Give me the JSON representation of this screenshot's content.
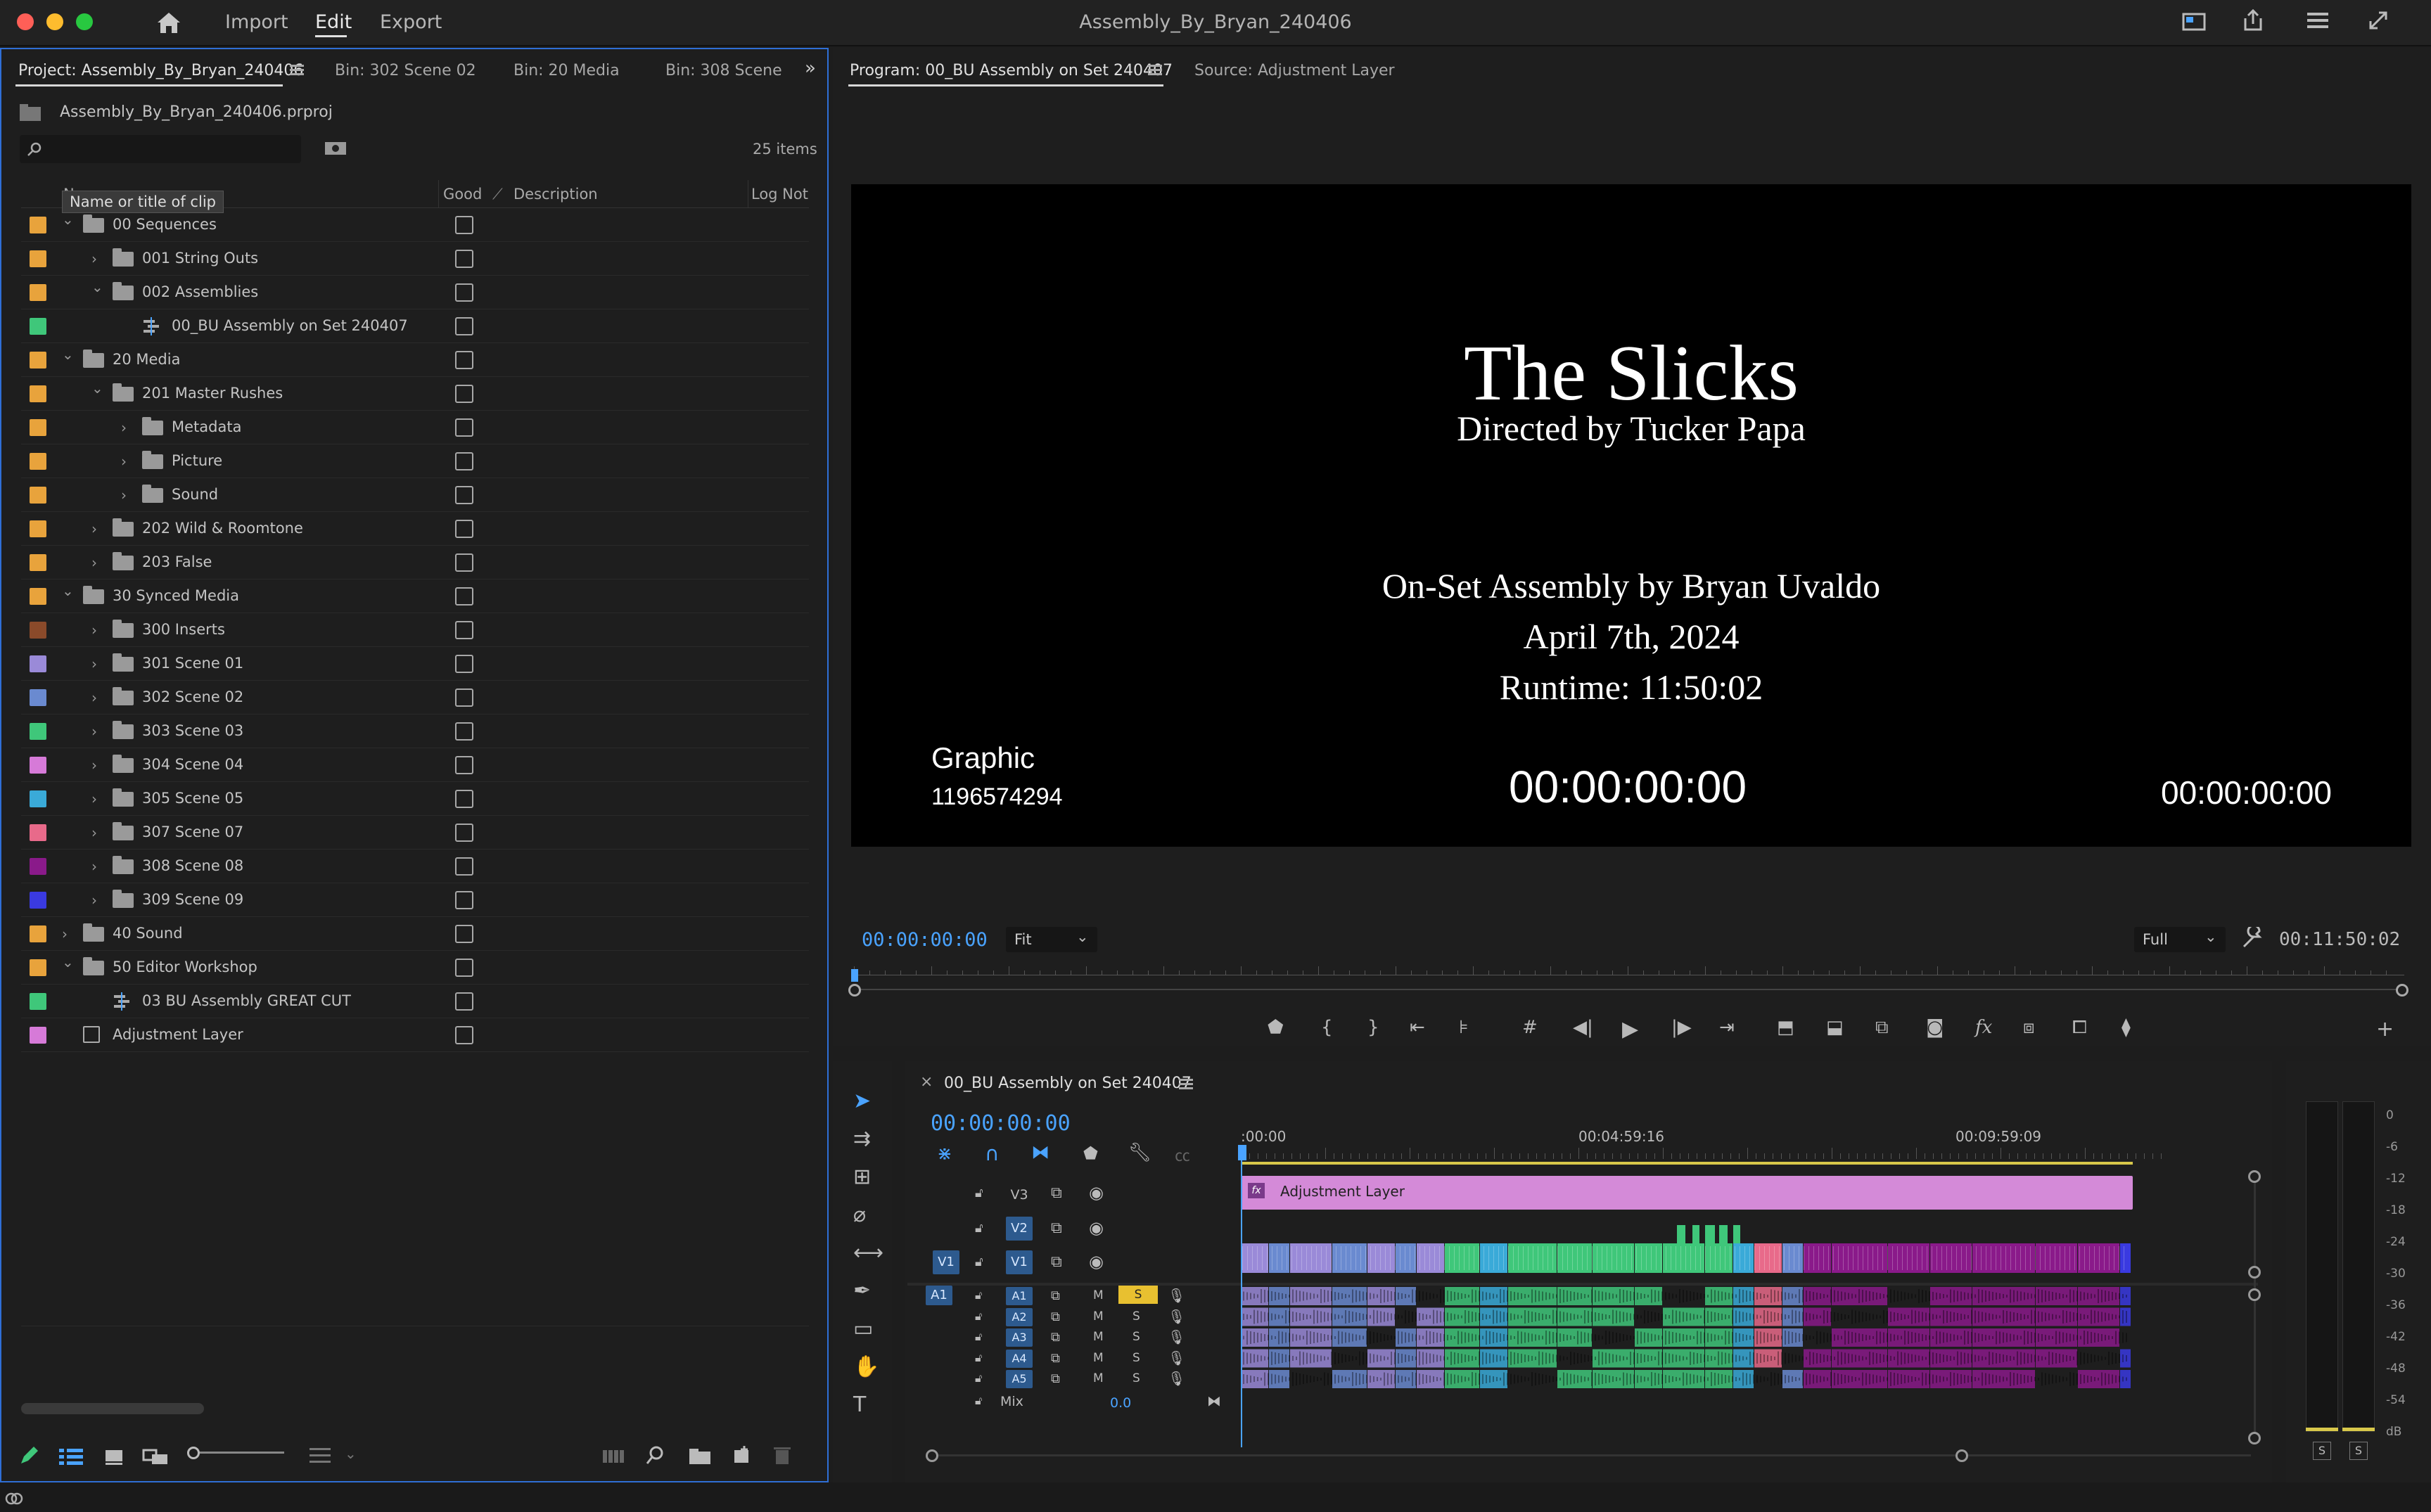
{
  "titlebar": {
    "workspaces": [
      "Import",
      "Edit",
      "Export"
    ],
    "active_workspace": "Edit",
    "window_title": "Assembly_By_Bryan_240406"
  },
  "project": {
    "tabs": [
      "Project: Assembly_By_Bryan_240406",
      "Bin: 302 Scene 02",
      "Bin: 20 Media",
      "Bin: 308 Scene"
    ],
    "file_name": "Assembly_By_Bryan_240406.prproj",
    "search_placeholder": "",
    "item_count": "25 items",
    "tooltip": "Name or title of clip",
    "columns": [
      "Name",
      "Good",
      "Description",
      "Log Note"
    ],
    "items": [
      {
        "label": "00 Sequences",
        "color": "#e8a33c",
        "indent": 0,
        "arrow": "open",
        "icon": "folder"
      },
      {
        "label": "001 String Outs",
        "color": "#e8a33c",
        "indent": 1,
        "arrow": "closed",
        "icon": "folder"
      },
      {
        "label": "002 Assemblies",
        "color": "#e8a33c",
        "indent": 1,
        "arrow": "open",
        "icon": "folder"
      },
      {
        "label": "00_BU Assembly on Set 240407",
        "color": "#3fc77a",
        "indent": 2,
        "arrow": "none",
        "icon": "sequence"
      },
      {
        "label": "20 Media",
        "color": "#e8a33c",
        "indent": 0,
        "arrow": "open",
        "icon": "folder"
      },
      {
        "label": "201 Master Rushes",
        "color": "#e8a33c",
        "indent": 1,
        "arrow": "open",
        "icon": "folder"
      },
      {
        "label": "Metadata",
        "color": "#e8a33c",
        "indent": 2,
        "arrow": "closed",
        "icon": "folder"
      },
      {
        "label": "Picture",
        "color": "#e8a33c",
        "indent": 2,
        "arrow": "closed",
        "icon": "folder"
      },
      {
        "label": "Sound",
        "color": "#e8a33c",
        "indent": 2,
        "arrow": "closed",
        "icon": "folder"
      },
      {
        "label": "202 Wild & Roomtone",
        "color": "#e8a33c",
        "indent": 1,
        "arrow": "closed",
        "icon": "folder"
      },
      {
        "label": "203 False",
        "color": "#e8a33c",
        "indent": 1,
        "arrow": "closed",
        "icon": "folder"
      },
      {
        "label": "30 Synced Media",
        "color": "#e8a33c",
        "indent": 0,
        "arrow": "open",
        "icon": "folder"
      },
      {
        "label": "300 Inserts",
        "color": "#8a4a2a",
        "indent": 1,
        "arrow": "closed",
        "icon": "folder"
      },
      {
        "label": "301 Scene 01",
        "color": "#9a8ad8",
        "indent": 1,
        "arrow": "closed",
        "icon": "folder"
      },
      {
        "label": "302 Scene 02",
        "color": "#6a8ad0",
        "indent": 1,
        "arrow": "closed",
        "icon": "folder"
      },
      {
        "label": "303 Scene 03",
        "color": "#3fc77a",
        "indent": 1,
        "arrow": "closed",
        "icon": "folder"
      },
      {
        "label": "304 Scene 04",
        "color": "#d67ad8",
        "indent": 1,
        "arrow": "closed",
        "icon": "folder"
      },
      {
        "label": "305 Scene 05",
        "color": "#3aaad8",
        "indent": 1,
        "arrow": "closed",
        "icon": "folder"
      },
      {
        "label": "307 Scene 07",
        "color": "#e86a8a",
        "indent": 1,
        "arrow": "closed",
        "icon": "folder"
      },
      {
        "label": "308 Scene 08",
        "color": "#8a1a8a",
        "indent": 1,
        "arrow": "closed",
        "icon": "folder"
      },
      {
        "label": "309 Scene 09",
        "color": "#3a3ae0",
        "indent": 1,
        "arrow": "closed",
        "icon": "folder"
      },
      {
        "label": "40 Sound",
        "color": "#e8a33c",
        "indent": 0,
        "arrow": "closed",
        "icon": "folder"
      },
      {
        "label": "50 Editor Workshop",
        "color": "#e8a33c",
        "indent": 0,
        "arrow": "open",
        "icon": "folder"
      },
      {
        "label": "03 BU Assembly GREAT CUT",
        "color": "#3fc77a",
        "indent": 1,
        "arrow": "none",
        "icon": "sequence"
      },
      {
        "label": "Adjustment Layer",
        "color": "#d67ad8",
        "indent": 0,
        "arrow": "none",
        "icon": "adjustment"
      }
    ]
  },
  "program": {
    "tabs": [
      "Program: 00_BU Assembly on Set 240407",
      "Source: Adjustment Layer"
    ],
    "title_card": {
      "title": "The Slicks",
      "directed": "Directed by Tucker Papa",
      "assembly": "On-Set Assembly by Bryan Uvaldo",
      "date": "April 7th, 2024",
      "runtime": "Runtime: 11:50:02"
    },
    "burnin": {
      "clip_name": "Graphic",
      "clip_id": "1196574294",
      "timecode_center": "00:00:00:00",
      "timecode_right": "00:00:00:00"
    },
    "playhead_tc": "00:00:00:00",
    "fit": "Fit",
    "resolution": "Full",
    "duration": "00:11:50:02"
  },
  "timeline": {
    "sequence_name": "00_BU Assembly on Set 240407",
    "timecode": "00:00:00:00",
    "ruler": [
      ":00:00",
      "00:04:59:16",
      "00:09:59:09"
    ],
    "video_tracks": [
      "V3",
      "V2",
      "V1"
    ],
    "audio_tracks": [
      "A1",
      "A2",
      "A3",
      "A4",
      "A5"
    ],
    "source_v": "V1",
    "source_a": "A1",
    "mix_label": "Mix",
    "mix_value": "0.0",
    "m_label": "M",
    "s_label": "S",
    "adjustment_clip": "Adjustment Layer"
  },
  "meter": {
    "scale": [
      "0",
      "-6",
      "-12",
      "-18",
      "-24",
      "-30",
      "-36",
      "-42",
      "-48",
      "-54",
      "dB"
    ],
    "solo": [
      "S",
      "S"
    ]
  }
}
